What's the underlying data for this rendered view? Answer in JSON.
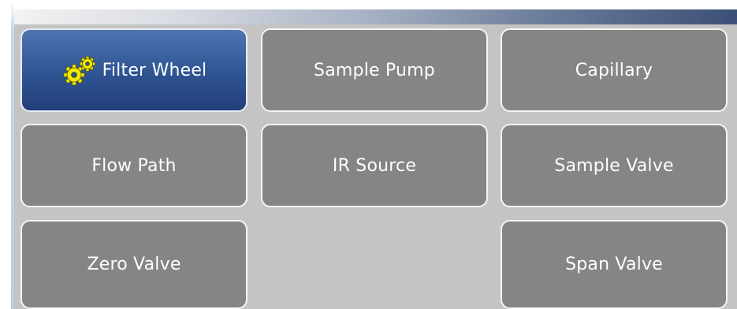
{
  "header": {
    "title": ""
  },
  "menu": {
    "buttons": [
      {
        "label": "Filter Wheel",
        "icon": "gears-icon",
        "active": true
      },
      {
        "label": "Sample Pump",
        "active": false
      },
      {
        "label": "Capillary",
        "active": false
      },
      {
        "label": "Flow Path",
        "active": false
      },
      {
        "label": "IR Source",
        "active": false
      },
      {
        "label": "Sample Valve",
        "active": false
      },
      {
        "label": "Zero Valve",
        "active": false
      },
      {
        "label": "Span Valve",
        "active": false
      }
    ]
  },
  "colors": {
    "panel_bg": "#c4c4c4",
    "button_bg": "#858585",
    "active_button_bg": "#2e5492",
    "gear_color": "#f2ea00",
    "text": "#ffffff"
  }
}
